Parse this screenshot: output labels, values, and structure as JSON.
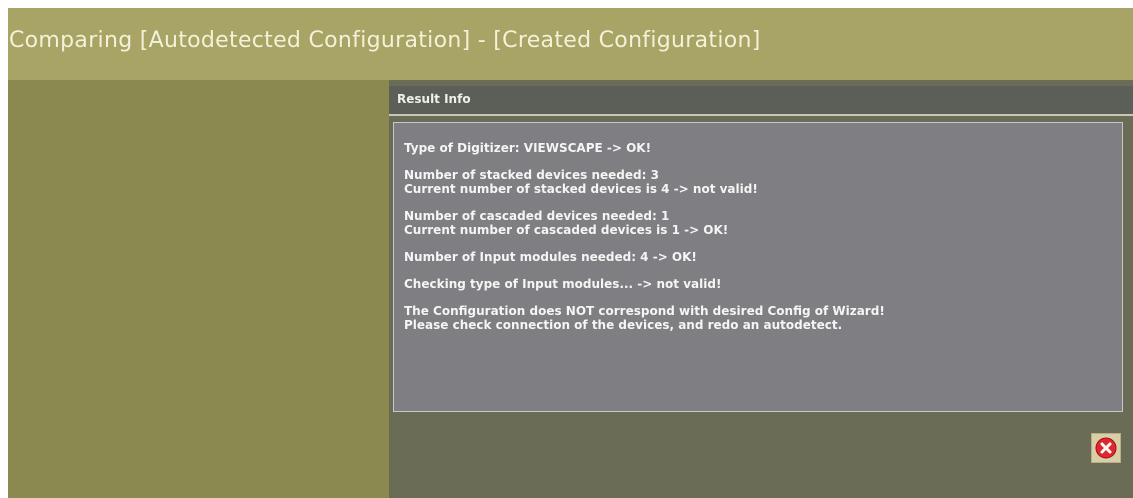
{
  "window": {
    "title": "Comparing [Autodetected Configuration] - [Created Configuration]"
  },
  "result_panel": {
    "header_label": "Result Info",
    "paragraphs": [
      [
        "Type of Digitizer: VIEWSCAPE -> OK!"
      ],
      [
        "Number of stacked devices needed: 3",
        "Current number of stacked devices is 4 -> not valid!"
      ],
      [
        "Number of cascaded devices needed: 1",
        "Current number of cascaded devices is 1 -> OK!"
      ],
      [
        "Number of Input modules needed: 4 -> OK!"
      ],
      [
        "Checking type of Input modules... -> not valid!"
      ],
      [
        "The Configuration does NOT correspond with desired Config of Wizard!",
        "Please check connection of the devices, and redo an autodetect."
      ]
    ]
  },
  "footer": {
    "close_icon": "close-circle-icon"
  },
  "colors": {
    "header_bg": "#a7a466",
    "body_bg": "#8c8950",
    "panel_bg": "#6b6c55",
    "result_bg": "#7f7e82",
    "close_red": "#e0262e"
  }
}
